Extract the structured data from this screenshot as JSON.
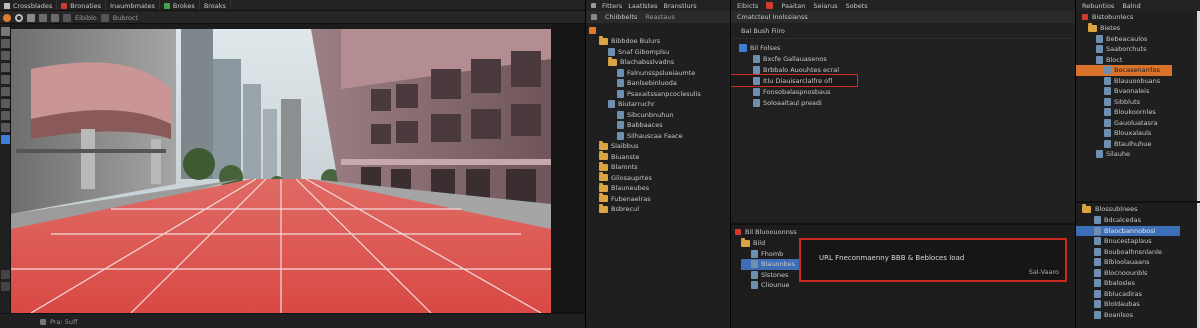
{
  "viewport": {
    "top_items": [
      "Crossblades",
      "Bronaties",
      "Inaumbmates",
      "Brokes",
      "Broaks"
    ],
    "tool_items": [
      "Eibiblo",
      "Bubroct"
    ],
    "bottom_text": "Pra: 5uff"
  },
  "outliner": {
    "top_items": [
      "Fitters",
      "Laatlstes",
      "Branstlurs"
    ],
    "tabs": [
      "Chiibbelts",
      "Reastaus"
    ],
    "items": [
      {
        "label": "Bibbdoe Bulurs",
        "indent": 1,
        "icon": "folder"
      },
      {
        "label": "Snaf Gibomplsu",
        "indent": 2,
        "icon": "doc"
      },
      {
        "label": "Blachabsslvadns",
        "indent": 2,
        "icon": "folder"
      },
      {
        "label": "Falnunsspslueiaumte",
        "indent": 3,
        "icon": "doc"
      },
      {
        "label": "Banlsebinluoda",
        "indent": 3,
        "icon": "doc"
      },
      {
        "label": "Psaxaitssanpcoclesulis",
        "indent": 3,
        "icon": "doc"
      },
      {
        "label": "Biutarruchr",
        "indent": 2,
        "icon": "doc"
      },
      {
        "label": "Sibcunbnuhun",
        "indent": 3,
        "icon": "doc"
      },
      {
        "label": "Babbaaces",
        "indent": 3,
        "icon": "doc"
      },
      {
        "label": "Silhauscaa Faace",
        "indent": 3,
        "icon": "doc"
      },
      {
        "label": "Slaibbus",
        "indent": 1,
        "icon": "folder"
      },
      {
        "label": "Biuanste",
        "indent": 1,
        "icon": "folder"
      },
      {
        "label": "Blamnts",
        "indent": 1,
        "icon": "folder"
      },
      {
        "label": "Gilosauprtes",
        "indent": 1,
        "icon": "folder"
      },
      {
        "label": "Blauneubes",
        "indent": 1,
        "icon": "folder"
      },
      {
        "label": "Fubenaelras",
        "indent": 1,
        "icon": "folder"
      },
      {
        "label": "Bsbrecul",
        "indent": 1,
        "icon": "folder"
      }
    ]
  },
  "middle": {
    "top_items": [
      "Eibicts",
      "Paaitan",
      "Seiarus",
      "Sobets"
    ],
    "tabs": [
      "Cmatcteul Inolssianss"
    ],
    "header": "Bal Bush Fiiro",
    "items": [
      {
        "label": "Bil Folses",
        "indent": 0
      },
      {
        "label": "Bxcfe Gallauasenos",
        "indent": 1
      },
      {
        "label": "Brbbalo Auouhtes ecral",
        "indent": 1
      },
      {
        "label": "Itlu Diauisarclalfre ofl",
        "indent": 1,
        "selected": true
      },
      {
        "label": "Fonsobalaspnosbaus",
        "indent": 1
      },
      {
        "label": "Soloaaltaul preadi",
        "indent": 1
      }
    ],
    "lower_header": "Bil Bluoouonnss",
    "lower_items": [
      "Bild",
      "Fhomb",
      "Blauonbes",
      "Slstones",
      "Cliounue"
    ],
    "notice_text": "URL Fneconmaenny BBB & Bebloces Ioad",
    "notice_tag": "Sal-Vaaro"
  },
  "right": {
    "top_items": [
      "Rebuntios",
      "Balnd"
    ],
    "header": "Bistobunlecs",
    "items": [
      {
        "label": "Bietes",
        "indent": 1
      },
      {
        "label": "Bebeacaulos",
        "indent": 2
      },
      {
        "label": "Saaborchuts",
        "indent": 2
      },
      {
        "label": "Bloct",
        "indent": 2
      },
      {
        "label": "Bocasenarrlos",
        "indent": 3,
        "hl": "orange"
      },
      {
        "label": "Blauuoobuans",
        "indent": 3
      },
      {
        "label": "Bvaonaleis",
        "indent": 3
      },
      {
        "label": "Sibbluts",
        "indent": 3
      },
      {
        "label": "Bloukoornles",
        "indent": 3
      },
      {
        "label": "Gauoluatasra",
        "indent": 3
      },
      {
        "label": "Blouxalauls",
        "indent": 3
      },
      {
        "label": "Btaulhuhue",
        "indent": 3
      },
      {
        "label": "Silauhe",
        "indent": 2
      }
    ],
    "lower_header": "Blossublnees",
    "lower_items": [
      {
        "label": "Bdcalcedas",
        "hl": ""
      },
      {
        "label": "Blaocbannobosi",
        "hl": "blue"
      },
      {
        "label": "Bnucestaplaus",
        "hl": ""
      },
      {
        "label": "Bouboalhnsnlanle",
        "hl": ""
      },
      {
        "label": "Blbloolauaans",
        "hl": ""
      },
      {
        "label": "Blocnoounbls",
        "hl": ""
      },
      {
        "label": "Bbalosles",
        "hl": ""
      },
      {
        "label": "Bblucadiras",
        "hl": ""
      },
      {
        "label": "Bloldaubas",
        "hl": ""
      },
      {
        "label": "Boanlsos",
        "hl": ""
      }
    ]
  }
}
